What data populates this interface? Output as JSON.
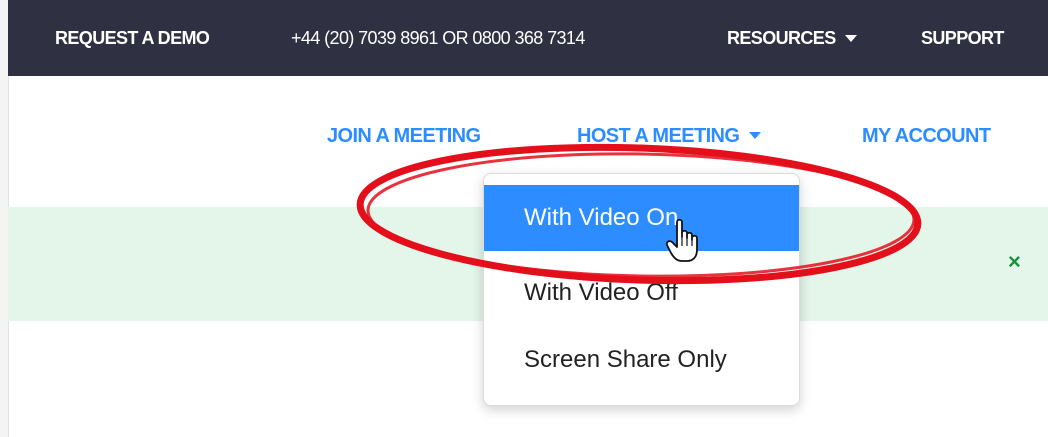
{
  "topbar": {
    "request_demo": "REQUEST A DEMO",
    "phone": "+44 (20) 7039 8961 OR 0800 368 7314",
    "resources": "RESOURCES",
    "support": "SUPPORT"
  },
  "nav": {
    "join": "JOIN A MEETING",
    "host": "HOST A MEETING",
    "account": "MY ACCOUNT"
  },
  "banner": {
    "close": "×"
  },
  "dropdown": {
    "items": [
      {
        "label": "With Video On"
      },
      {
        "label": "With Video Off"
      },
      {
        "label": "Screen Share Only"
      }
    ],
    "active_index": 0
  },
  "icons": {
    "menu_caret": "chevron-down-icon",
    "banner_close": "close-icon",
    "cursor": "hand-pointer-icon"
  },
  "colors": {
    "topbar_bg": "#2f3042",
    "link_blue": "#2d8cff",
    "banner_bg": "#e4f5e9",
    "close_green": "#1a8f3c",
    "annotation_red": "#e30f1b"
  }
}
